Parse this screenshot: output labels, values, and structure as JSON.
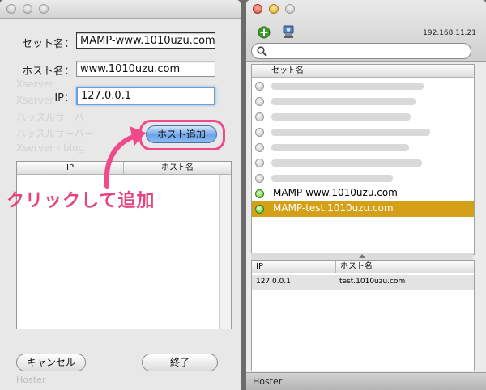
{
  "sheet": {
    "ghost_items": [
      "Xserver",
      "Xserver",
      "ハッスルサーバー",
      "ハッスルサーバー",
      "Xserver - blog"
    ],
    "set_name": {
      "label": "セット名：",
      "value": "MAMP-www.1010uzu.com"
    },
    "host_name": {
      "label": "ホスト名：",
      "value": "www.1010uzu.com"
    },
    "ip": {
      "label": "IP：",
      "value": "127.0.0.1"
    },
    "add_host_label": "ホスト追加",
    "table_headers": {
      "ip": "IP",
      "host": "ホスト名"
    },
    "cancel_label": "キャンセル",
    "done_label": "終了",
    "footer_text": "Hoster"
  },
  "annotation": {
    "text": "クリックして追加",
    "color": "#ef4a8a"
  },
  "main": {
    "ip_address": "192.168.11.21",
    "list_header": "セット名",
    "sets": [
      {
        "name": "",
        "active": false,
        "selected": false
      },
      {
        "name": "",
        "active": false,
        "selected": false
      },
      {
        "name": "",
        "active": false,
        "selected": false
      },
      {
        "name": "",
        "active": false,
        "selected": false
      },
      {
        "name": "",
        "active": false,
        "selected": false
      },
      {
        "name": "",
        "active": false,
        "selected": false
      },
      {
        "name": "",
        "active": false,
        "selected": false
      },
      {
        "name": "MAMP-www.1010uzu.com",
        "active": true,
        "selected": false
      },
      {
        "name": "MAMP-test.1010uzu.com",
        "active": true,
        "selected": true
      }
    ],
    "hosts_headers": {
      "ip": "IP",
      "host": "ホスト名"
    },
    "hosts": [
      {
        "ip": "127.0.0.1",
        "host": "test.1010uzu.com"
      }
    ],
    "status_text": "Hoster",
    "selection_color": "#d4a017"
  },
  "icons": {
    "add": "plus-circle-icon",
    "network": "network-icon",
    "search": "magnifier-icon"
  }
}
